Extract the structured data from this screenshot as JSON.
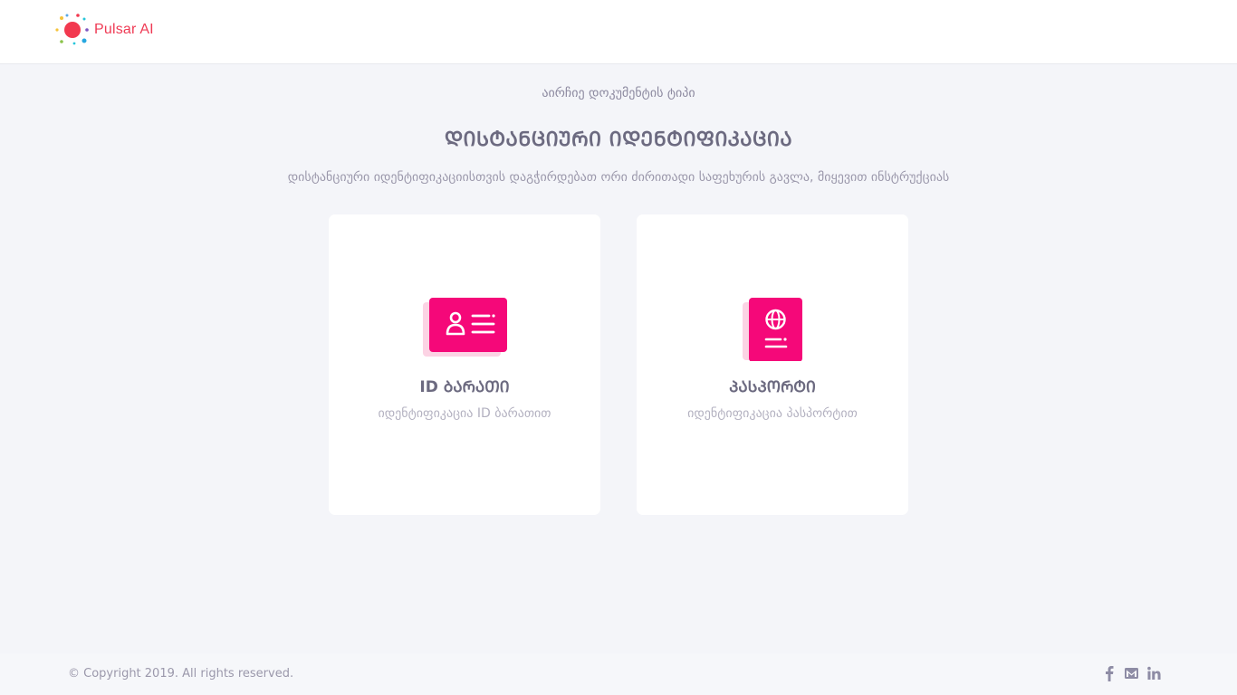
{
  "header": {
    "logo_text": "Pulsar AI",
    "logo_icon": "pulsar-logo-icon",
    "brand_color": "#ef3b55"
  },
  "main": {
    "subtitle": "აირჩიე დოკუმენტის ტიპი",
    "title": "ᲓᲘᲡᲢᲐᲜᲪᲘᲣᲠᲘ ᲘᲓᲔᲜᲢᲘᲤᲘᲙᲐᲪᲘᲐ",
    "description": "დისტანციური იდენტიფიკაციისთვის დაგჭირდებათ ორი ძირითადი საფეხურის გავლა, მიყევით ინსტრუქციას",
    "accent_color": "#f50879",
    "cards": [
      {
        "label": "ID ᲑᲐᲠᲐᲗᲘ",
        "sub": "იდენტიფიკაცია ID ბარათით",
        "icon": "id-card-icon"
      },
      {
        "label": "ᲞᲐᲡᲞᲝᲠᲢᲘ",
        "sub": "იდენტიფიკაცია პასპორტით",
        "icon": "passport-icon"
      }
    ]
  },
  "footer": {
    "copyright": "© Copyright 2019. All rights reserved.",
    "socials": [
      {
        "icon": "facebook-icon"
      },
      {
        "icon": "email-icon"
      },
      {
        "icon": "linkedin-icon"
      }
    ]
  }
}
